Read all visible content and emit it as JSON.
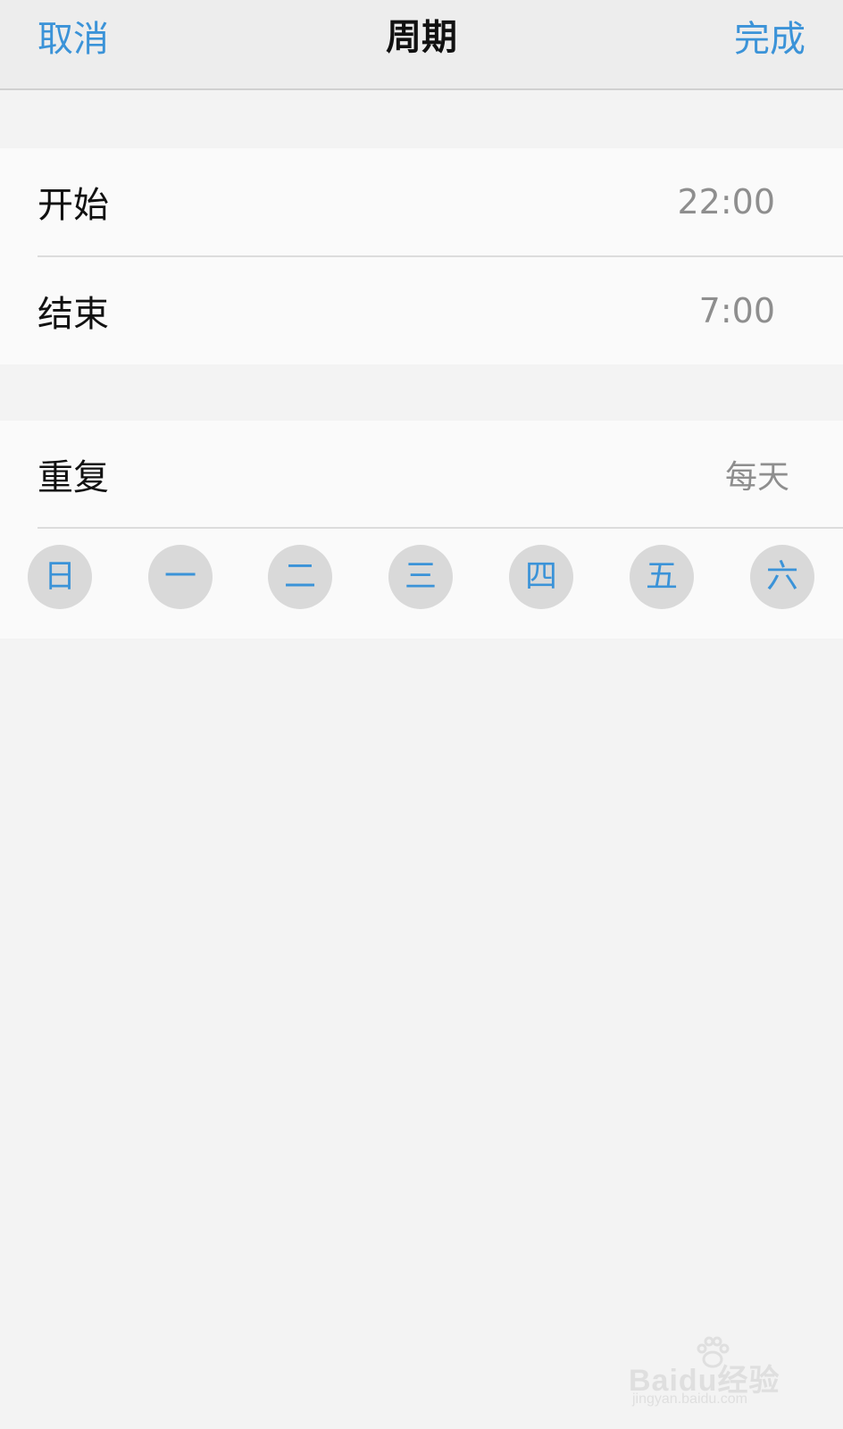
{
  "navbar": {
    "cancel_label": "取消",
    "title": "周期",
    "done_label": "完成"
  },
  "time_group": {
    "start": {
      "label": "开始",
      "value": "22:00"
    },
    "end": {
      "label": "结束",
      "value": "7:00"
    }
  },
  "repeat_group": {
    "label": "重复",
    "value": "每天",
    "days": [
      "日",
      "一",
      "二",
      "三",
      "四",
      "五",
      "六"
    ]
  },
  "watermark": {
    "brand": "Baidu经验",
    "url": "jingyan.baidu.com"
  },
  "colors": {
    "accent": "#3b93d8",
    "background": "#f3f3f3",
    "cell": "#fafafa",
    "day_circle": "#d9d9d9"
  }
}
